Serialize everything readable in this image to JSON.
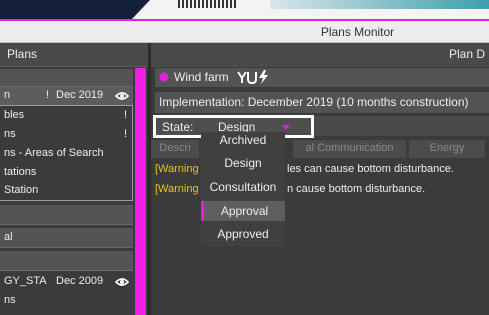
{
  "window": {
    "title": "Plans Monitor"
  },
  "left_panel": {
    "header": "Plans",
    "items": [
      {
        "label": "n",
        "date": "Dec 2019",
        "warn": "!"
      },
      {
        "label": "bles",
        "warn": "!"
      },
      {
        "label": "ns",
        "warn": "!"
      },
      {
        "label": "ns - Areas of Search"
      },
      {
        "label": "tations"
      },
      {
        "label": "Station"
      }
    ],
    "bar1": "",
    "bar2": "al",
    "bar3": "",
    "item_gy": {
      "label": "GY_STA",
      "date": "Dec 2009"
    },
    "item_last": "ns"
  },
  "right_panel": {
    "header": "Plan D",
    "plan_name": "Wind farm",
    "implementation": "Implementation: December 2019 (10 months construction)",
    "state_label": "State:",
    "state_value": "Design",
    "tabs": [
      "Descri",
      "al Communication",
      "Energy"
    ],
    "warnings": [
      {
        "tag": "[Warning",
        "text": "les can cause bottom disturbance."
      },
      {
        "tag": "[Warning",
        "text": "n cause bottom disturbance."
      }
    ]
  },
  "state_dropdown": {
    "options": [
      "Archived",
      "Design",
      "Consultation",
      "Approval",
      "Approved"
    ],
    "highlighted": "Approval"
  },
  "colors": {
    "accent": "#e020e0",
    "warning": "#f0c020"
  }
}
